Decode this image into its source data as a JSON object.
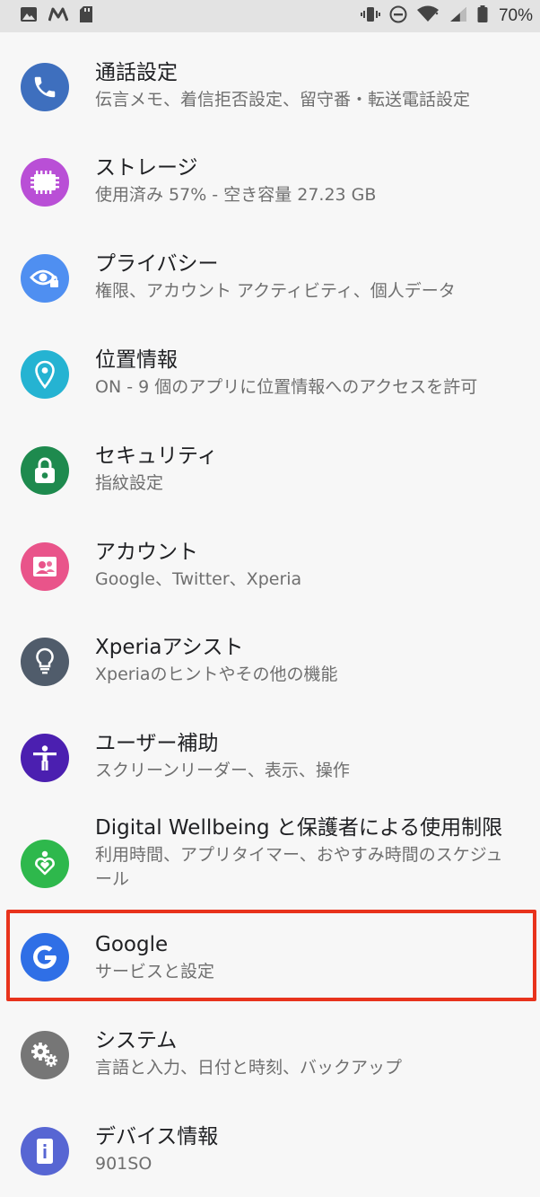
{
  "status_bar": {
    "battery_text": "70%",
    "left_icons": [
      "gallery-icon",
      "m-app-icon",
      "sd-card-icon"
    ],
    "right_icons": [
      "vibrate-icon",
      "do-not-disturb-icon",
      "wifi-icon",
      "signal-icon",
      "battery-icon"
    ]
  },
  "settings": [
    {
      "id": "call",
      "title": "通話設定",
      "subtitle": "伝言メモ、着信拒否設定、留守番・転送電話設定",
      "icon": "phone-icon",
      "color": "#3e6fbe"
    },
    {
      "id": "storage",
      "title": "ストレージ",
      "subtitle": "使用済み 57% - 空き容量 27.23 GB",
      "icon": "storage-icon",
      "color": "#b94fd6"
    },
    {
      "id": "privacy",
      "title": "プライバシー",
      "subtitle": "権限、アカウント アクティビティ、個人データ",
      "icon": "privacy-eye-icon",
      "color": "#4f8ff1"
    },
    {
      "id": "location",
      "title": "位置情報",
      "subtitle": "ON - 9 個のアプリに位置情報へのアクセスを許可",
      "icon": "location-pin-icon",
      "color": "#25b3d2"
    },
    {
      "id": "security",
      "title": "セキュリティ",
      "subtitle": "指紋設定",
      "icon": "lock-icon",
      "color": "#1e8a4e"
    },
    {
      "id": "accounts",
      "title": "アカウント",
      "subtitle": "Google、Twitter、Xperia",
      "icon": "accounts-icon",
      "color": "#e9548a"
    },
    {
      "id": "xperia-assist",
      "title": "Xperiaアシスト",
      "subtitle": "Xperiaのヒントやその他の機能",
      "icon": "lightbulb-icon",
      "color": "#505c6b"
    },
    {
      "id": "accessibility",
      "title": "ユーザー補助",
      "subtitle": "スクリーンリーダー、表示、操作",
      "icon": "accessibility-icon",
      "color": "#4b1fb0"
    },
    {
      "id": "digital-wellbeing",
      "title": "Digital Wellbeing と保護者による使用制限",
      "subtitle": "利用時間、アプリタイマー、おやすみ時間のスケジュール",
      "icon": "wellbeing-icon",
      "color": "#2eb84c"
    },
    {
      "id": "google",
      "title": "Google",
      "subtitle": "サービスと設定",
      "icon": "google-g-icon",
      "color": "#2f6fe6"
    },
    {
      "id": "system",
      "title": "システム",
      "subtitle": "言語と入力、日付と時刻、バックアップ",
      "icon": "gears-icon",
      "color": "#767676"
    },
    {
      "id": "about",
      "title": "デバイス情報",
      "subtitle": "901SO",
      "icon": "device-info-icon",
      "color": "#5766d3"
    }
  ],
  "highlight": {
    "color": "#e8331c",
    "target": "google"
  }
}
